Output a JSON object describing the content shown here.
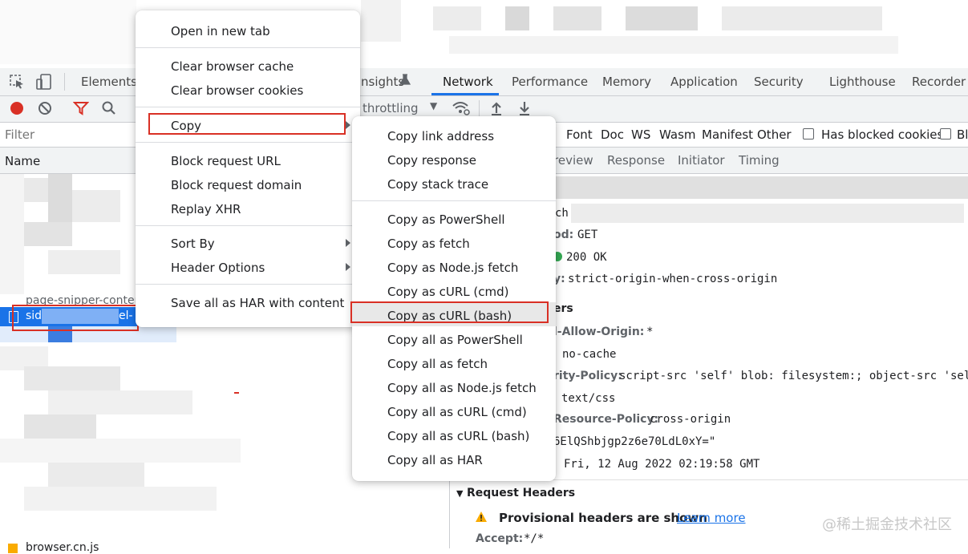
{
  "devtools": {
    "tabs": [
      "Elements",
      "nsights",
      "Network",
      "Performance",
      "Memory",
      "Application",
      "Security",
      "Lighthouse",
      "Recorder"
    ],
    "active_tab": "Network",
    "toolbar": {
      "throttling_label": "throttling"
    },
    "filter": {
      "placeholder": "Filter",
      "types": [
        "Font",
        "Doc",
        "WS",
        "Wasm",
        "Manifest",
        "Other"
      ],
      "blocked_cookies_label": "Has blocked cookies",
      "trailing_label": "Bl"
    },
    "name_header": "Name",
    "rows": {
      "partial_top": "page-snipper-conten",
      "selected_prefix": "sid",
      "selected_suffix": "el-",
      "bottom": "browser.cn.js"
    },
    "detail_tabs": [
      "review",
      "Response",
      "Initiator",
      "Timing"
    ],
    "general": {
      "url_frag": "ch",
      "method_key": "od:",
      "method_val": "GET",
      "status_val": "200 OK",
      "policy_key": "y:",
      "policy_val": "strict-origin-when-cross-origin"
    },
    "response_headers": {
      "title_frag": "ers",
      "rows": [
        {
          "key": "l-Allow-Origin:",
          "val": "*"
        },
        {
          "key": "",
          "val": "no-cache"
        },
        {
          "key": "rity-Policy:",
          "val": "script-src 'self' blob: filesystem:; object-src 'self'"
        },
        {
          "key": "",
          "val": "text/css"
        },
        {
          "key": "Resource-Policy:",
          "val": "cross-origin"
        },
        {
          "key": "",
          "val": "6ElQShbjgp2z6e70LdL0xY=\""
        },
        {
          "key": "",
          "val": "Fri, 12 Aug 2022 02:19:58 GMT"
        }
      ]
    },
    "request_headers": {
      "title": "Request Headers",
      "provisional_text": "Provisional headers are shown",
      "learn_more": "Learn more",
      "accept_key": "Accept:",
      "accept_val": "*/*"
    }
  },
  "context_menu": {
    "items": [
      "Open in new tab",
      "Clear browser cache",
      "Clear browser cookies",
      "Copy",
      "Block request URL",
      "Block request domain",
      "Replay XHR",
      "Sort By",
      "Header Options",
      "Save all as HAR with content"
    ]
  },
  "copy_submenu": {
    "items": [
      "Copy link address",
      "Copy response",
      "Copy stack trace",
      "Copy as PowerShell",
      "Copy as fetch",
      "Copy as Node.js fetch",
      "Copy as cURL (cmd)",
      "Copy as cURL (bash)",
      "Copy all as PowerShell",
      "Copy all as fetch",
      "Copy all as Node.js fetch",
      "Copy all as cURL (cmd)",
      "Copy all as cURL (bash)",
      "Copy all as HAR"
    ],
    "highlighted": "Copy as cURL (bash)"
  },
  "watermark": "@稀土掘金技术社区",
  "colors": {
    "accent": "#1a73e8",
    "annotation_red": "#d93025",
    "status_green": "#34a853",
    "warning_yellow": "#f9ab00"
  }
}
